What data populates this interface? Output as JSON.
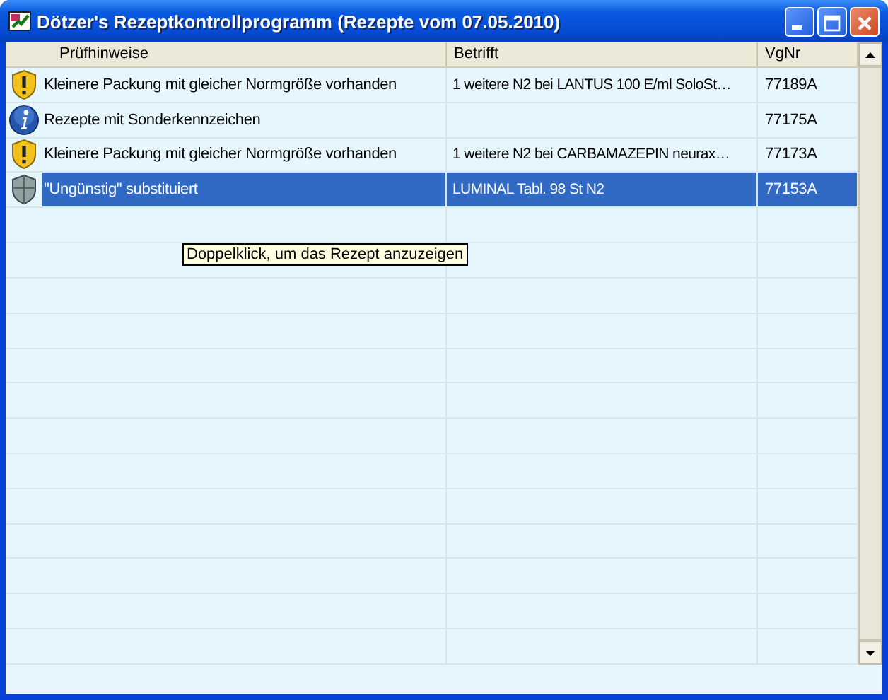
{
  "window": {
    "title": "Dötzer's Rezeptkontrollprogramm (Rezepte vom 07.05.2010)"
  },
  "table": {
    "columns": [
      "Prüfhinweise",
      "Betrifft",
      "VgNr"
    ],
    "rows": [
      {
        "kind": "warning",
        "hint": "Kleinere Packung mit gleicher Normgröße vorhanden",
        "concerns": "1 weitere N2 bei LANTUS 100 E/ml SoloSt…",
        "vgnr": "77189A",
        "selected": false
      },
      {
        "kind": "info",
        "hint": "Rezepte mit Sonderkennzeichen",
        "concerns": "",
        "vgnr": "77175A",
        "selected": false
      },
      {
        "kind": "warning",
        "hint": "Kleinere Packung mit gleicher Normgröße vorhanden",
        "concerns": "1 weitere N2 bei CARBAMAZEPIN neurax…",
        "vgnr": "77173A",
        "selected": false
      },
      {
        "kind": "shield",
        "hint": "\"Ungünstig\" substituiert",
        "concerns": "LUMINAL Tabl. 98 St N2",
        "vgnr": "77153A",
        "selected": true
      }
    ]
  },
  "tooltip": {
    "text": "Doppelklick, um das Rezept anzuzeigen"
  }
}
